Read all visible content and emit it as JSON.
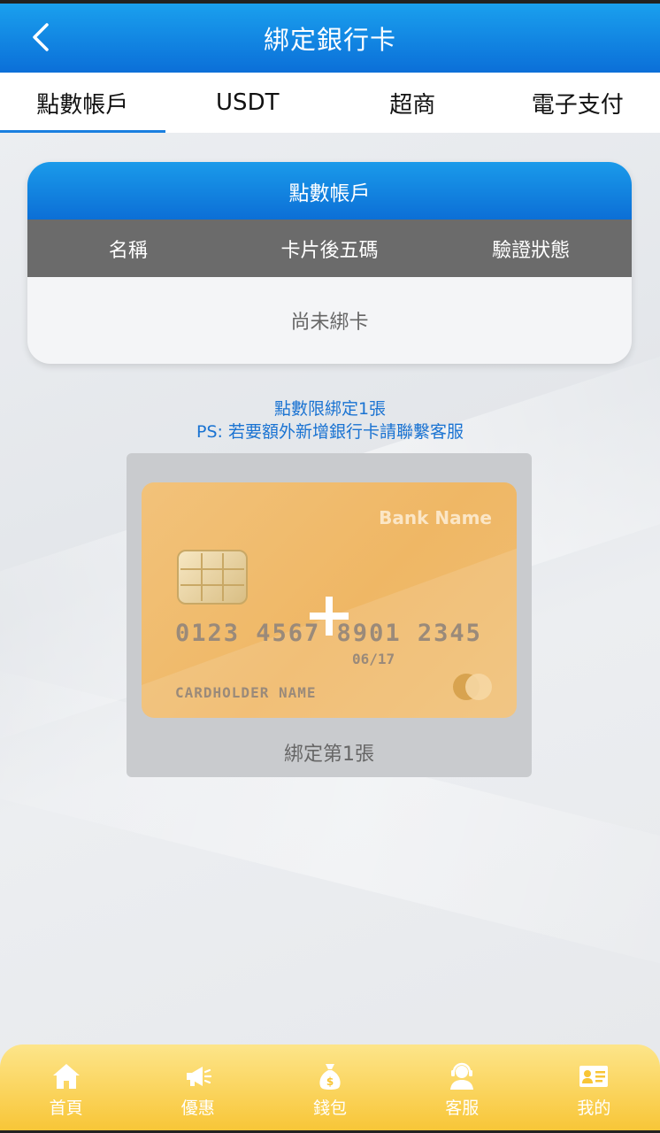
{
  "header": {
    "title": "綁定銀行卡",
    "back_icon": "chevron-left-icon"
  },
  "tabs": [
    {
      "label": "點數帳戶",
      "active": true
    },
    {
      "label": "USDT",
      "active": false
    },
    {
      "label": "超商",
      "active": false
    },
    {
      "label": "電子支付",
      "active": false
    }
  ],
  "panel": {
    "title": "點數帳戶",
    "columns": [
      "名稱",
      "卡片後五碼",
      "驗證狀態"
    ],
    "empty_text": "尚未綁卡"
  },
  "notes": {
    "limit": "點數限綁定1張",
    "ps": "PS: 若要額外新增銀行卡請聯繫客服"
  },
  "add_card": {
    "bank_name": "Bank Name",
    "card_number": "0123 4567 8901 2345",
    "expiry": "06/17",
    "holder": "CARDHOLDER NAME",
    "label": "綁定第1張"
  },
  "bottom_nav": [
    {
      "label": "首頁",
      "icon": "home-icon"
    },
    {
      "label": "優惠",
      "icon": "megaphone-icon"
    },
    {
      "label": "錢包",
      "icon": "money-bag-icon"
    },
    {
      "label": "客服",
      "icon": "support-agent-icon"
    },
    {
      "label": "我的",
      "icon": "id-card-icon"
    }
  ],
  "colors": {
    "primary": "#0b6fd8",
    "accent_yellow": "#f8c535",
    "note_blue": "#1a73d2"
  }
}
